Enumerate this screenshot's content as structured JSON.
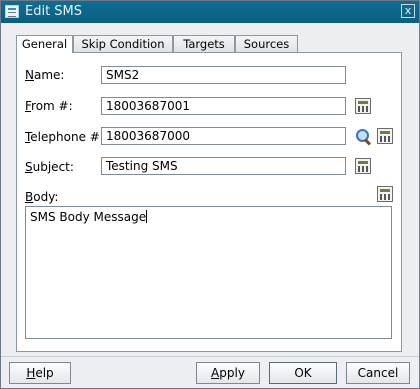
{
  "window": {
    "title": "Edit SMS",
    "close_glyph": "x"
  },
  "tabs": [
    {
      "label": "General",
      "active": true
    },
    {
      "label": "Skip Condition",
      "active": false
    },
    {
      "label": "Targets",
      "active": false
    },
    {
      "label": "Sources",
      "active": false
    }
  ],
  "form": {
    "name": {
      "mnemonic": "N",
      "rest": "ame:",
      "value": "SMS2"
    },
    "from": {
      "mnemonic": "F",
      "rest": "rom #:",
      "value": "18003687001"
    },
    "telephone": {
      "mnemonic": "T",
      "rest": "elephone #:",
      "value": "18003687000"
    },
    "subject": {
      "mnemonic": "S",
      "rest": "ubject:",
      "value": "Testing SMS"
    },
    "body": {
      "mnemonic": "B",
      "rest": "ody:",
      "value": "SMS Body Message"
    }
  },
  "icons": {
    "expression_builder": "expression-builder-icon",
    "search": "magnifier-icon"
  },
  "buttons": {
    "help": {
      "mnemonic": "H",
      "rest": "elp"
    },
    "apply": {
      "mnemonic": "A",
      "rest": "pply"
    },
    "ok": "OK",
    "cancel": "Cancel"
  }
}
